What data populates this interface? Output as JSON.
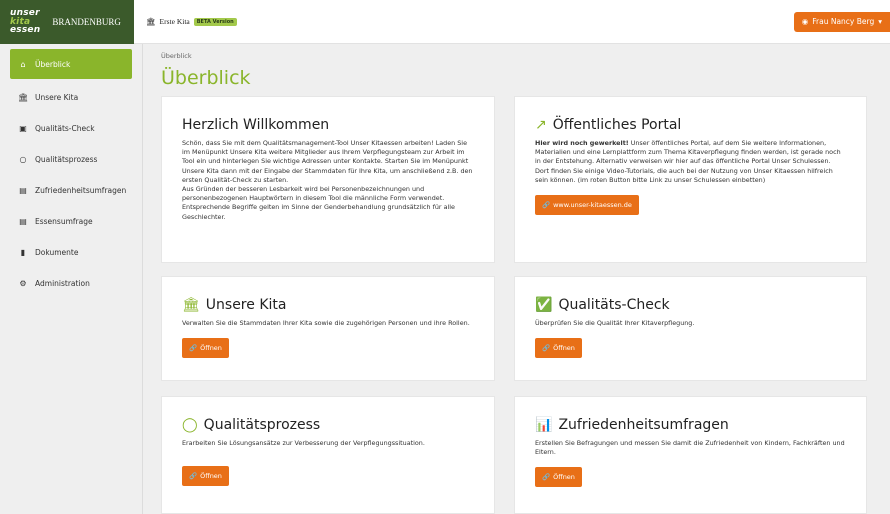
{
  "brand": {
    "logo_line1": "unser",
    "logo_line2": "kita",
    "logo_line3": "essen",
    "region": "BRANDENBURG"
  },
  "header": {
    "kita_name": "Erste Kita",
    "beta_badge": "BETA Version",
    "user_label": "Frau Nancy Berg"
  },
  "sidebar": {
    "items": [
      {
        "label": "Überblick",
        "icon": "home-icon"
      },
      {
        "label": "Unsere Kita",
        "icon": "building-icon"
      },
      {
        "label": "Qualitäts-Check",
        "icon": "clipboard-check-icon"
      },
      {
        "label": "Qualitätsprozess",
        "icon": "circle-icon"
      },
      {
        "label": "Zufriedenheitsumfragen",
        "icon": "chart-icon"
      },
      {
        "label": "Essensumfrage",
        "icon": "chart-icon"
      },
      {
        "label": "Dokumente",
        "icon": "document-icon"
      },
      {
        "label": "Administration",
        "icon": "cogs-icon"
      }
    ]
  },
  "main": {
    "breadcrumb": "Überblick",
    "title": "Überblick",
    "welcome": {
      "title": "Herzlich Willkommen",
      "text1": "Schön, dass Sie mit dem Qualitätsmanagement-Tool Unser Kitaessen arbeiten! Laden Sie im Menüpunkt Unsere Kita weitere Mitglieder aus Ihrem Verpflegungsteam zur Arbeit im Tool ein und hinterlegen Sie wichtige Adressen unter Kontakte. Starten Sie im Menüpunkt Unsere Kita dann mit der Eingabe der Stammdaten für Ihre Kita, um anschließend z.B. den ersten Qualität-Check zu starten.",
      "text2": "Aus Gründen der besseren Lesbarkeit wird bei Personenbezeichnungen und personenbezogenen Hauptwörtern in diesem Tool die männliche Form verwendet. Entsprechende Begriffe gelten im Sinne der Genderbehandlung grundsätzlich für alle Geschlechter."
    },
    "portal": {
      "title": "Öffentliches Portal",
      "bold": "Hier wird noch gewerkelt!",
      "text": " Unser öffentliches Portal, auf dem Sie weitere Informationen, Materialien und eine Lernplattform zum Thema Kitaverpflegung finden werden, ist gerade noch in der Entstehung. Alternativ verweisen wir hier auf das öffentliche Portal Unser Schulessen. Dort finden Sie einige Video-Tutorials, die auch bei der Nutzung von Unser Kitaessen hilfreich sein können. (im roten Button bitte Link zu unser Schulessen einbetten)",
      "button": "www.unser-kitaessen.de"
    },
    "kita": {
      "title": "Unsere Kita",
      "text": "Verwalten Sie die Stammdaten Ihrer Kita sowie die zugehörigen Personen und ihre Rollen.",
      "button": "Öffnen"
    },
    "check": {
      "title": "Qualitäts-Check",
      "text": "Überprüfen Sie die Qualität Ihrer Kitaverpflegung.",
      "button": "Öffnen"
    },
    "prozess": {
      "title": "Qualitätsprozess",
      "text": "Erarbeiten Sie Lösungsansätze zur Verbesserung der Verpflegungssituation.",
      "button": "Öffnen"
    },
    "umfragen": {
      "title": "Zufriedenheitsumfragen",
      "text": "Erstellen Sie Befragungen und messen Sie damit die Zufriedenheit von Kindern, Fachkräften und Eltern.",
      "button": "Öffnen"
    }
  },
  "colors": {
    "brand_dark": "#3b5a2b",
    "accent_green": "#8ab52b",
    "accent_orange": "#e86f17"
  }
}
